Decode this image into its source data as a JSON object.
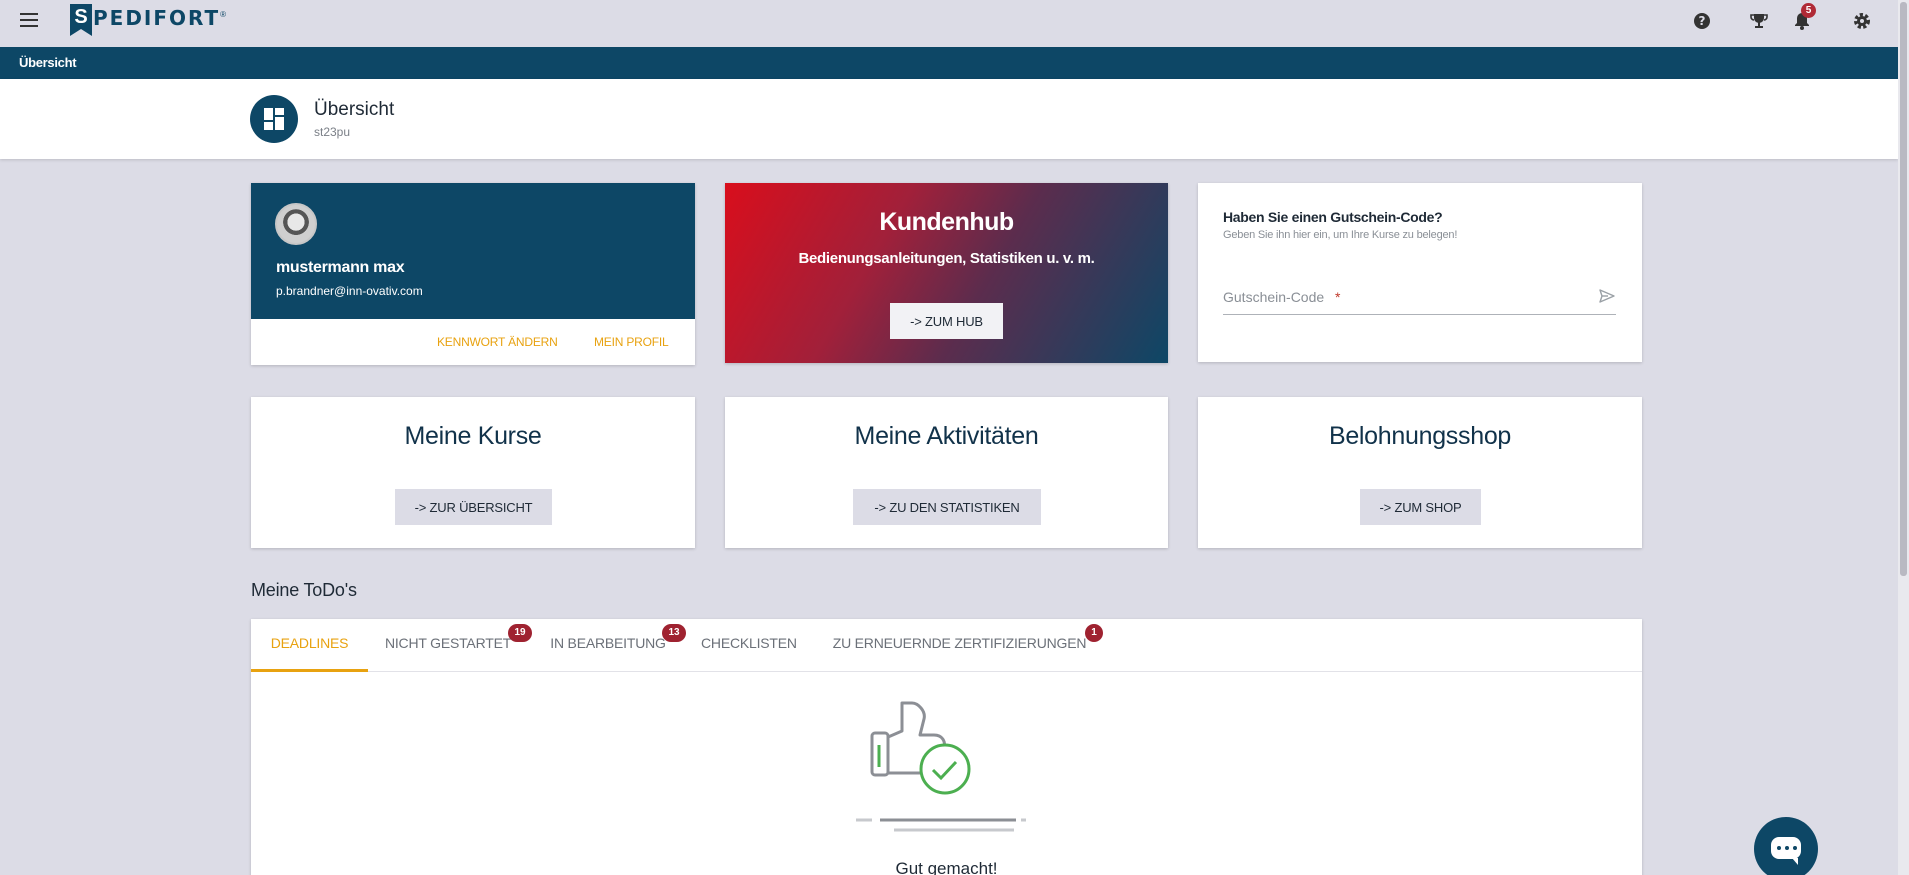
{
  "header": {
    "logo_text": "PEDIFORT",
    "logo_letter": "S",
    "notification_count": "5",
    "icons": [
      "menu-icon",
      "help-icon",
      "trophy-icon",
      "bell-icon",
      "gear-icon"
    ]
  },
  "nav": {
    "breadcrumb": "Übersicht"
  },
  "page": {
    "title": "Übersicht",
    "subtitle": "st23pu"
  },
  "profile": {
    "name": "mustermann max",
    "email": "p.brandner@inn-ovativ.com",
    "change_password": "KENNWORT ÄNDERN",
    "my_profile": "MEIN PROFIL"
  },
  "hub": {
    "title": "Kundenhub",
    "subtitle": "Bedienungsanleitungen, Statistiken u. v. m.",
    "button": "-> ZUM HUB"
  },
  "voucher": {
    "title": "Haben Sie einen Gutschein-Code?",
    "subtitle": "Geben Sie ihn hier ein, um Ihre Kurse zu belegen!",
    "placeholder": "Gutschein-Code",
    "required_mark": "*"
  },
  "cards": [
    {
      "title": "Meine Kurse",
      "button": "-> ZUR ÜBERSICHT"
    },
    {
      "title": "Meine Aktivitäten",
      "button": "-> ZU DEN STATISTIKEN"
    },
    {
      "title": "Belohnungsshop",
      "button": "-> ZUM SHOP"
    }
  ],
  "todos": {
    "title": "Meine ToDo's",
    "tabs": [
      {
        "label": "DEADLINES",
        "badge": ""
      },
      {
        "label": "NICHT GESTARTET",
        "badge": "19"
      },
      {
        "label": "IN BEARBEITUNG",
        "badge": "13"
      },
      {
        "label": "CHECKLISTEN",
        "badge": ""
      },
      {
        "label": "ZU ERNEUERNDE ZERTIFIZIERUNGEN",
        "badge": "1"
      }
    ],
    "active_tab": "DEADLINES",
    "empty_text": "Gut gemacht!"
  },
  "colors": {
    "primary": "#0d4766",
    "accent": "#e8a210",
    "badge": "#9f2230",
    "background": "#dcdce6"
  }
}
